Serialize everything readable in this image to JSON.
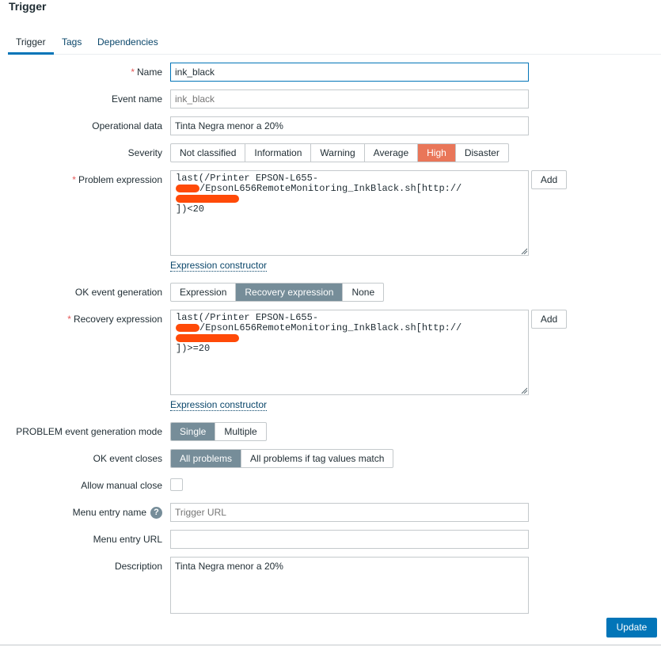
{
  "title": "Trigger",
  "tabs": [
    {
      "label": "Trigger",
      "active": true
    },
    {
      "label": "Tags",
      "active": false
    },
    {
      "label": "Dependencies",
      "active": false
    }
  ],
  "form": {
    "name": {
      "label": "Name",
      "value": "ink_black"
    },
    "event_name": {
      "label": "Event name",
      "placeholder": "ink_black"
    },
    "operational_data": {
      "label": "Operational data",
      "value": "Tinta Negra menor a 20%"
    },
    "severity": {
      "label": "Severity",
      "options": [
        "Not classified",
        "Information",
        "Warning",
        "Average",
        "High",
        "Disaster"
      ],
      "selected": "High"
    },
    "problem_expression": {
      "label": "Problem expression",
      "line1": "last(/Printer EPSON-L655-",
      "line2": "/EpsonL656RemoteMonitoring_InkBlack.sh[http://",
      "line3": "])<20",
      "add_label": "Add",
      "constructor_link": "Expression constructor"
    },
    "ok_event_generation": {
      "label": "OK event generation",
      "options": [
        "Expression",
        "Recovery expression",
        "None"
      ],
      "selected": "Recovery expression"
    },
    "recovery_expression": {
      "label": "Recovery expression",
      "line1": "last(/Printer EPSON-L655-",
      "line2": "/EpsonL656RemoteMonitoring_InkBlack.sh[http://",
      "line3": "])>=20",
      "add_label": "Add",
      "constructor_link": "Expression constructor"
    },
    "problem_mode": {
      "label": "PROBLEM event generation mode",
      "options": [
        "Single",
        "Multiple"
      ],
      "selected": "Single"
    },
    "ok_event_closes": {
      "label": "OK event closes",
      "options": [
        "All problems",
        "All problems if tag values match"
      ],
      "selected": "All problems"
    },
    "allow_manual_close": {
      "label": "Allow manual close",
      "checked": false
    },
    "menu_entry_name": {
      "label": "Menu entry name",
      "placeholder": "Trigger URL",
      "help_icon": "?"
    },
    "menu_entry_url": {
      "label": "Menu entry URL",
      "value": ""
    },
    "description": {
      "label": "Description",
      "value": "Tinta Negra menor a 20%"
    }
  },
  "update_button": "Update",
  "colors": {
    "accent": "#0275b8",
    "severity_high": "#e97659",
    "selected_option": "#768d99",
    "required": "#e45959",
    "redaction": "#ff4a08"
  }
}
